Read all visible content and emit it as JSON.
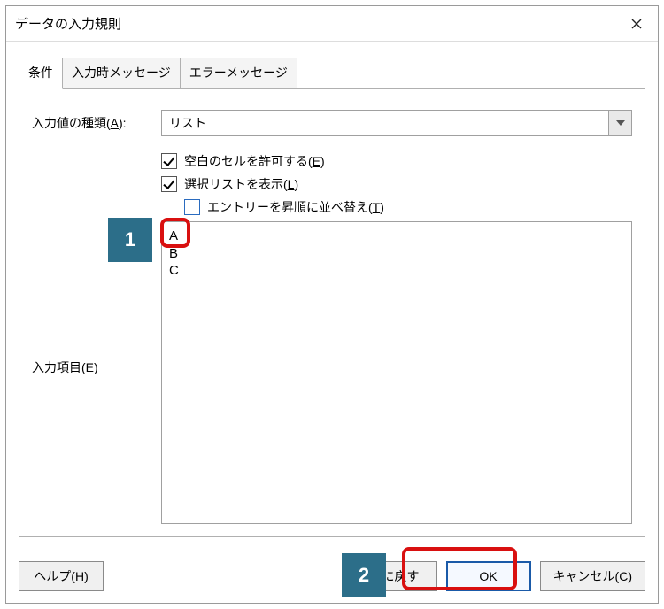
{
  "dialog": {
    "title": "データの入力規則"
  },
  "tabs": {
    "conditions": "条件",
    "input_help": "入力時メッセージ",
    "error_msg": "エラーメッセージ"
  },
  "form": {
    "allow_label_pre": "入力値の種類(",
    "allow_label_key": "A",
    "allow_label_post": "):",
    "allow_value": "リスト",
    "allow_blank_pre": "空白のセルを許可する(",
    "allow_blank_key": "E",
    "allow_blank_post": ")",
    "allow_blank_checked": true,
    "show_list_pre": "選択リストを表示(",
    "show_list_key": "L",
    "show_list_post": ")",
    "show_list_checked": true,
    "sort_asc_pre": "エントリーを昇順に並べ替え(",
    "sort_asc_key": "T",
    "sort_asc_post": ")",
    "sort_asc_checked": false,
    "entries_label_pre": "入力項目(",
    "entries_label_key": "E",
    "entries_label_post": ")",
    "entries_value": "A\nB\nC"
  },
  "buttons": {
    "help_pre": "ヘルプ(",
    "help_key": "H",
    "help_post": ")",
    "reset": "元に戻す",
    "ok_key": "O",
    "ok_post": "K",
    "cancel_pre": "キャンセル(",
    "cancel_key": "C",
    "cancel_post": ")"
  },
  "annotations": {
    "one": "1",
    "two": "2"
  }
}
